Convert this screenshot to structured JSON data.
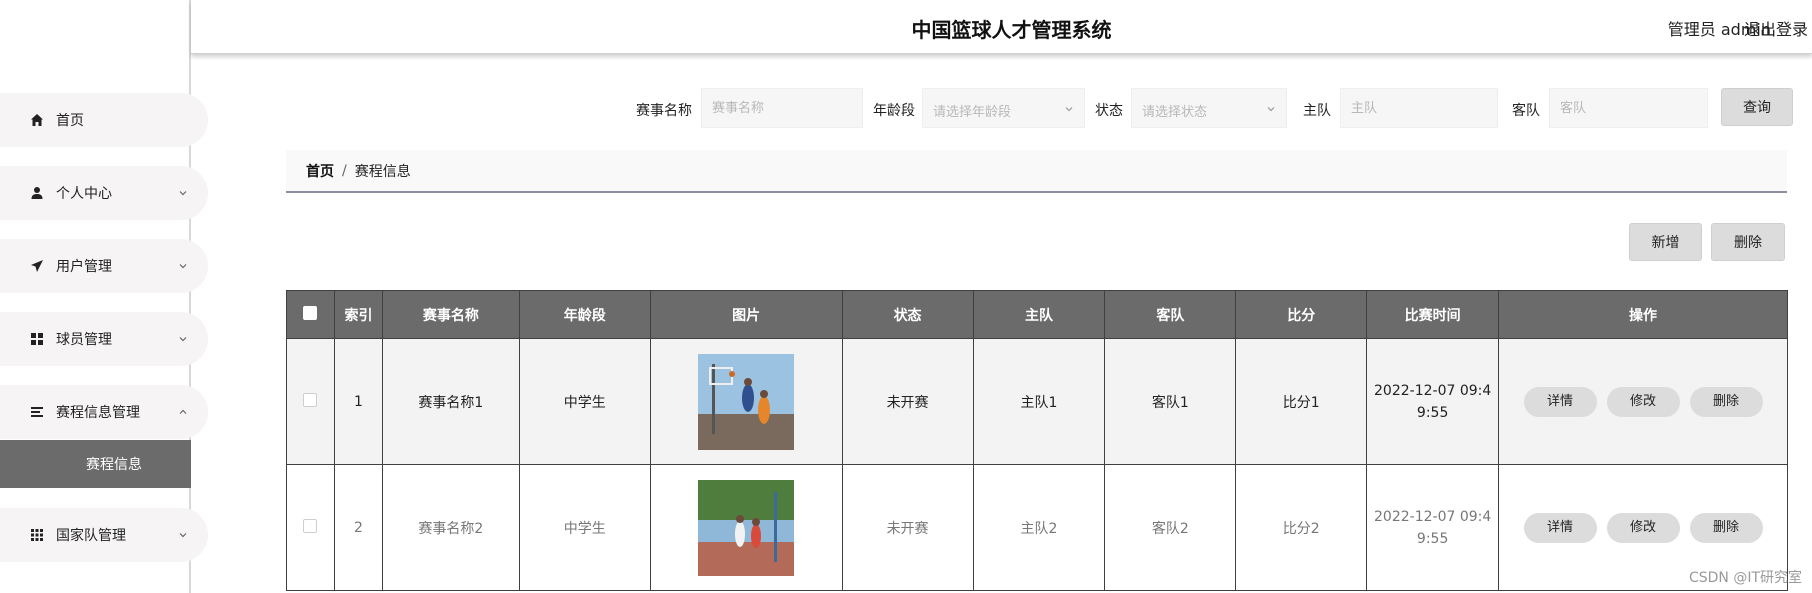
{
  "header": {
    "title": "中国篮球人才管理系统",
    "user": "管理员 admin",
    "logout": "退出登录"
  },
  "sidebar": {
    "items": [
      {
        "label": "首页",
        "icon": "home-icon"
      },
      {
        "label": "个人中心",
        "icon": "user-icon"
      },
      {
        "label": "用户管理",
        "icon": "send-icon"
      },
      {
        "label": "球员管理",
        "icon": "grid-icon"
      },
      {
        "label": "赛程信息管理",
        "icon": "list-icon"
      },
      {
        "label": "国家队管理",
        "icon": "apps-icon"
      }
    ],
    "submenu": {
      "label": "赛程信息"
    }
  },
  "search": {
    "match_name_label": "赛事名称",
    "match_name_placeholder": "赛事名称",
    "age_label": "年龄段",
    "age_placeholder": "请选择年龄段",
    "status_label": "状态",
    "status_placeholder": "请选择状态",
    "home_label": "主队",
    "home_placeholder": "主队",
    "away_label": "客队",
    "away_placeholder": "客队",
    "query_button": "查询"
  },
  "breadcrumb": {
    "home": "首页",
    "separator": "/",
    "current": "赛程信息"
  },
  "actions": {
    "add": "新增",
    "delete": "删除"
  },
  "table": {
    "headers": [
      "索引",
      "赛事名称",
      "年龄段",
      "图片",
      "状态",
      "主队",
      "客队",
      "比分",
      "比赛时间",
      "操作"
    ],
    "rows": [
      {
        "index": "1",
        "name": "赛事名称1",
        "age": "中学生",
        "status": "未开赛",
        "home": "主队1",
        "away": "客队1",
        "score": "比分1",
        "time_a": "2022-12-07 09:4",
        "time_b": "9:55"
      },
      {
        "index": "2",
        "name": "赛事名称2",
        "age": "中学生",
        "status": "未开赛",
        "home": "主队2",
        "away": "客队2",
        "score": "比分2",
        "time_a": "2022-12-07 09:4",
        "time_b": "9:55"
      }
    ],
    "row_ops": {
      "detail": "详情",
      "edit": "修改",
      "delete": "删除"
    }
  },
  "watermark": "CSDN @IT研究室",
  "colors": {
    "header_bg": "#6b6b6b",
    "active_menu": "#6b6b6b",
    "button_gray": "#dcdcdc"
  }
}
